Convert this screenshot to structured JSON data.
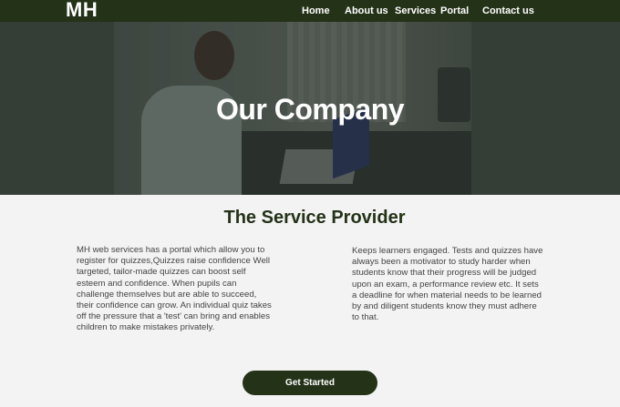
{
  "header": {
    "logo": "MH",
    "nav": {
      "home": "Home",
      "about": "About us",
      "services": "Services",
      "portal": "Portal",
      "contact": "Contact us"
    }
  },
  "hero": {
    "title": "Our Company"
  },
  "main": {
    "section_title": "The Service Provider",
    "left_text": "MH web services has a portal which allow you to register for quizzes,Quizzes raise confidence Well targeted, tailor-made quizzes can boost self esteem and confidence. When pupils can challenge themselves but are able to succeed, their confidence can grow. An individual quiz takes off the pressure that a 'test' can bring and enables children to make mistakes privately.",
    "right_text": "Keeps learners engaged. Tests and quizzes have always been a motivator to study harder when students know that their progress will be judged upon an exam, a performance review etc. It sets a deadline for when material needs to be learned by and diligent students know they must adhere to that.",
    "cta_label": "Get Started"
  },
  "colors": {
    "brand": "#243218",
    "page_bg": "#f3f3f3",
    "text": "#444444"
  }
}
